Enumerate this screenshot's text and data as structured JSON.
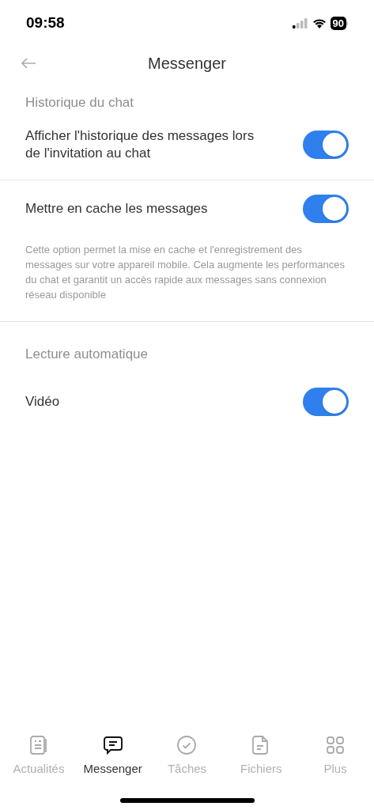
{
  "status_bar": {
    "time": "09:58",
    "battery": "90"
  },
  "header": {
    "title": "Messenger"
  },
  "sections": [
    {
      "title": "Historique du chat",
      "rows": [
        {
          "label": "Afficher l'historique des messages lors de l'invitation au chat",
          "on": true
        }
      ]
    },
    {
      "rows": [
        {
          "label": "Mettre en cache les messages",
          "on": true,
          "description": "Cette option permet la mise en cache et l'enregistrement des messages sur votre appareil mobile. Cela augmente les performances du chat et garantit un accès rapide aux messages sans connexion réseau disponible"
        }
      ]
    },
    {
      "title": "Lecture automatique",
      "rows": [
        {
          "label": "Vidéo",
          "on": true
        }
      ]
    }
  ],
  "tabs": [
    {
      "label": "Actualités",
      "selected": false
    },
    {
      "label": "Messenger",
      "selected": true
    },
    {
      "label": "Tâches",
      "selected": false
    },
    {
      "label": "Fichiers",
      "selected": false
    },
    {
      "label": "Plus",
      "selected": false
    }
  ]
}
